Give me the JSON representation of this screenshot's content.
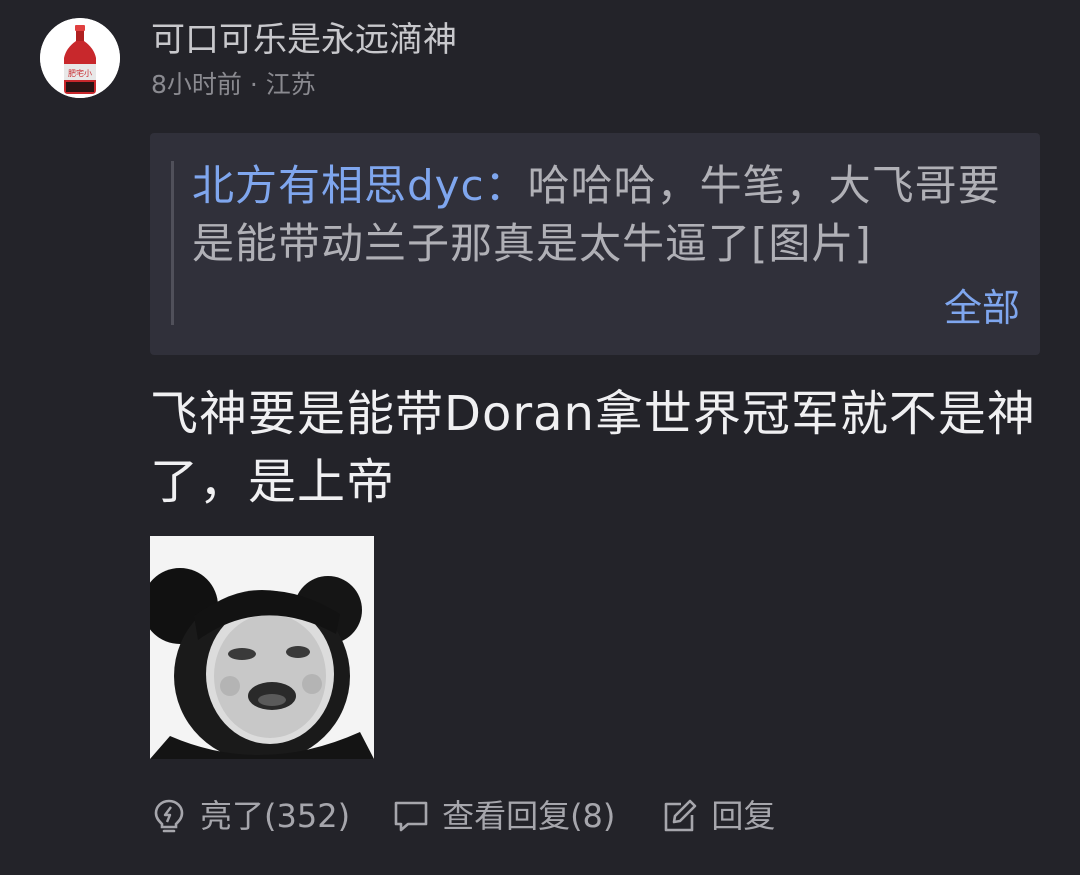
{
  "post": {
    "username": "可口可乐是永远滴神",
    "meta": "8小时前 · 江苏",
    "avatar_label": "肥宅小"
  },
  "quote": {
    "author": "北方有相思dyc：",
    "text": "哈哈哈，牛笔，大飞哥要是能带动兰子那真是太牛逼了[图片]",
    "expand_label": "全部"
  },
  "content": {
    "text": "飞神要是能带Doran拿世界冠军就不是神了，是上帝"
  },
  "actions": {
    "like_label": "亮了(352)",
    "view_replies_label": "查看回复(8)",
    "reply_label": "回复"
  },
  "colors": {
    "background": "#232329",
    "quote_background": "#30303a",
    "link": "#7fa6ee",
    "text_primary": "#f0f0f2",
    "text_secondary": "#8a8a90",
    "avatar_bottle": "#c8282c"
  },
  "icons": {
    "like": "lightbulb-icon",
    "view_replies": "comment-bubble-icon",
    "reply": "edit-pencil-icon"
  }
}
